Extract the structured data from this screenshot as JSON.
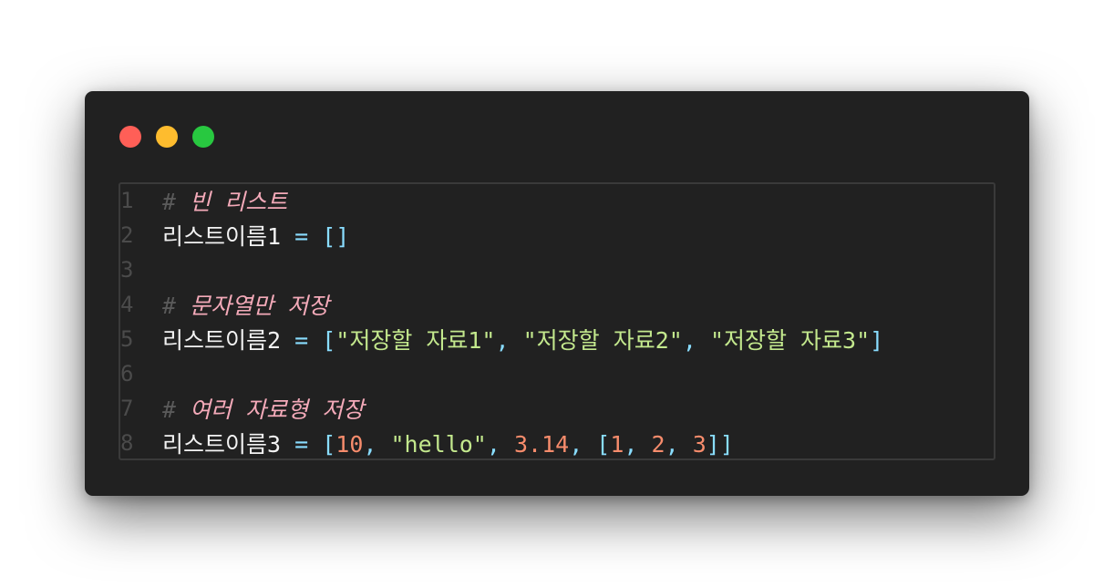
{
  "window": {
    "traffic_lights": {
      "close_color": "#ff5f57",
      "minimize_color": "#febc2e",
      "maximize_color": "#28c840"
    }
  },
  "code": {
    "lines": [
      {
        "number": "1",
        "tokens": [
          {
            "type": "hash",
            "text": "# "
          },
          {
            "type": "comment",
            "text": "빈 리스트"
          }
        ]
      },
      {
        "number": "2",
        "tokens": [
          {
            "type": "ident",
            "text": "리스트이름1"
          },
          {
            "type": "op",
            "text": " = []"
          }
        ]
      },
      {
        "number": "3",
        "tokens": []
      },
      {
        "number": "4",
        "tokens": [
          {
            "type": "hash",
            "text": "# "
          },
          {
            "type": "comment",
            "text": "문자열만 저장"
          }
        ]
      },
      {
        "number": "5",
        "tokens": [
          {
            "type": "ident",
            "text": "리스트이름2"
          },
          {
            "type": "op",
            "text": " = ["
          },
          {
            "type": "str",
            "text": "\"저장할 자료1\""
          },
          {
            "type": "op",
            "text": ", "
          },
          {
            "type": "str",
            "text": "\"저장할 자료2\""
          },
          {
            "type": "op",
            "text": ", "
          },
          {
            "type": "str",
            "text": "\"저장할 자료3\""
          },
          {
            "type": "op",
            "text": "]"
          }
        ]
      },
      {
        "number": "6",
        "tokens": []
      },
      {
        "number": "7",
        "tokens": [
          {
            "type": "hash",
            "text": "# "
          },
          {
            "type": "comment",
            "text": "여러 자료형 저장"
          }
        ]
      },
      {
        "number": "8",
        "tokens": [
          {
            "type": "ident",
            "text": "리스트이름3"
          },
          {
            "type": "op",
            "text": " = ["
          },
          {
            "type": "num",
            "text": "10"
          },
          {
            "type": "op",
            "text": ", "
          },
          {
            "type": "str",
            "text": "\"hello\""
          },
          {
            "type": "op",
            "text": ", "
          },
          {
            "type": "num",
            "text": "3.14"
          },
          {
            "type": "op",
            "text": ", ["
          },
          {
            "type": "num",
            "text": "1"
          },
          {
            "type": "op",
            "text": ", "
          },
          {
            "type": "num",
            "text": "2"
          },
          {
            "type": "op",
            "text": ", "
          },
          {
            "type": "num",
            "text": "3"
          },
          {
            "type": "op",
            "text": "]]"
          }
        ]
      }
    ]
  }
}
